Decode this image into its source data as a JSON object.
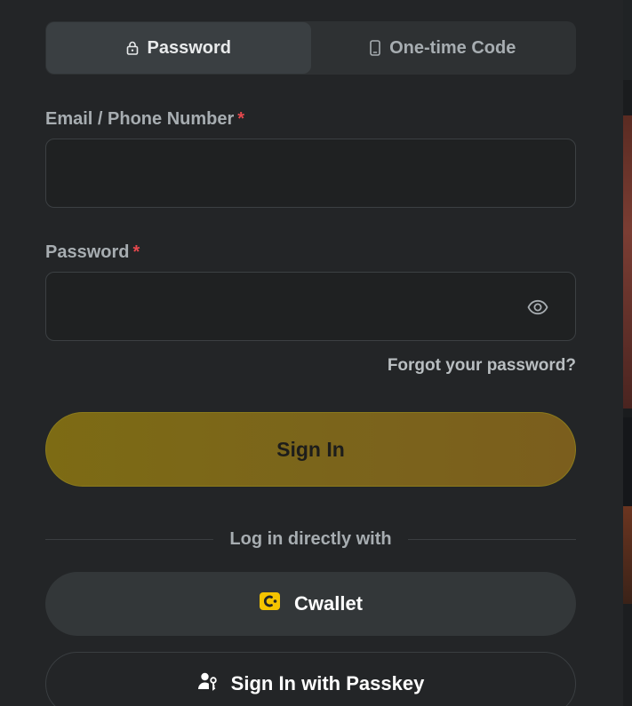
{
  "tabs": {
    "password": {
      "label": "Password",
      "icon": "lock-icon"
    },
    "otp": {
      "label": "One-time Code",
      "icon": "phone-icon"
    },
    "active": "password"
  },
  "form": {
    "email": {
      "label": "Email / Phone Number",
      "required_mark": "*",
      "value": "",
      "placeholder": ""
    },
    "password": {
      "label": "Password",
      "required_mark": "*",
      "value": "",
      "placeholder": ""
    },
    "forgot_label": "Forgot your password?",
    "submit_label": "Sign In"
  },
  "alt_login": {
    "divider_label": "Log in directly with",
    "cwallet_label": "Cwallet",
    "passkey_label": "Sign In with Passkey"
  },
  "colors": {
    "background": "#232527",
    "accent": "#7d6b14",
    "required": "#e5484d",
    "brand_cwallet": "#f5c400"
  }
}
